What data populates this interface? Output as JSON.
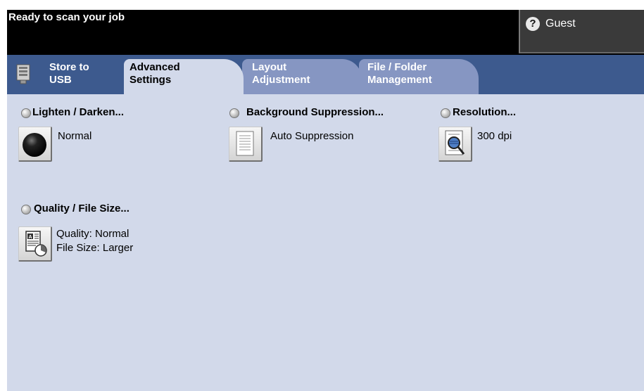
{
  "status": {
    "text": "Ready to scan your job"
  },
  "user": {
    "label": "Guest",
    "icon": "help-question-icon"
  },
  "tabs": [
    {
      "label_line1": "Store to",
      "label_line2": "USB"
    },
    {
      "label_line1": "Advanced",
      "label_line2": "Settings"
    },
    {
      "label_line1": "Layout",
      "label_line2": "Adjustment"
    },
    {
      "label_line1": "File / Folder",
      "label_line2": "Management"
    }
  ],
  "settings": {
    "lighten": {
      "heading": "Lighten / Darken...",
      "value": "Normal"
    },
    "background": {
      "heading": "Background Suppression...",
      "value": "Auto Suppression"
    },
    "resolution": {
      "heading": "Resolution...",
      "value": "300 dpi"
    },
    "quality": {
      "heading": "Quality / File Size...",
      "value_line1": "Quality: Normal",
      "value_line2": "File Size: Larger"
    }
  },
  "colors": {
    "tabbar": "#3d5a8e",
    "active_tab": "#d2d9ea",
    "inactive_tab": "#8696c2",
    "panel": "#d2d9ea"
  }
}
